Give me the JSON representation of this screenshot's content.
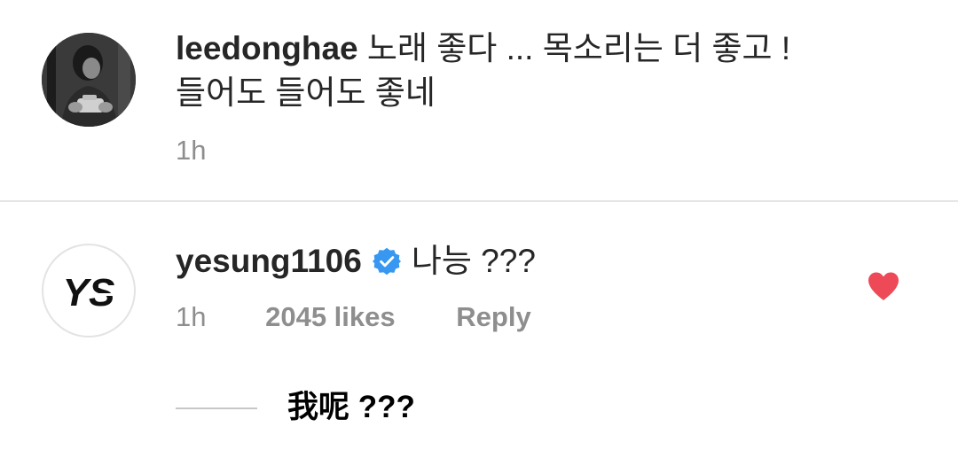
{
  "comments": [
    {
      "username": "leedonghae",
      "text": "노래 좋다 ... 목소리는 더 좋고 !",
      "text_line2": "들어도 들어도 좋네",
      "time": "1h",
      "avatar_icon": "profile-photo"
    },
    {
      "username": "yesung1106",
      "verified": true,
      "text": "나능 ???",
      "time": "1h",
      "likes": "2045 likes",
      "reply_label": "Reply",
      "liked": true,
      "avatar_icon": "ys-logo",
      "avatar_text": "YS"
    }
  ],
  "replies_toggle": {
    "label": "我呢 ???"
  },
  "colors": {
    "verified_badge": "#3897f0",
    "heart": "#ed4956",
    "meta_text": "#8e8e8e",
    "primary_text": "#262626"
  }
}
